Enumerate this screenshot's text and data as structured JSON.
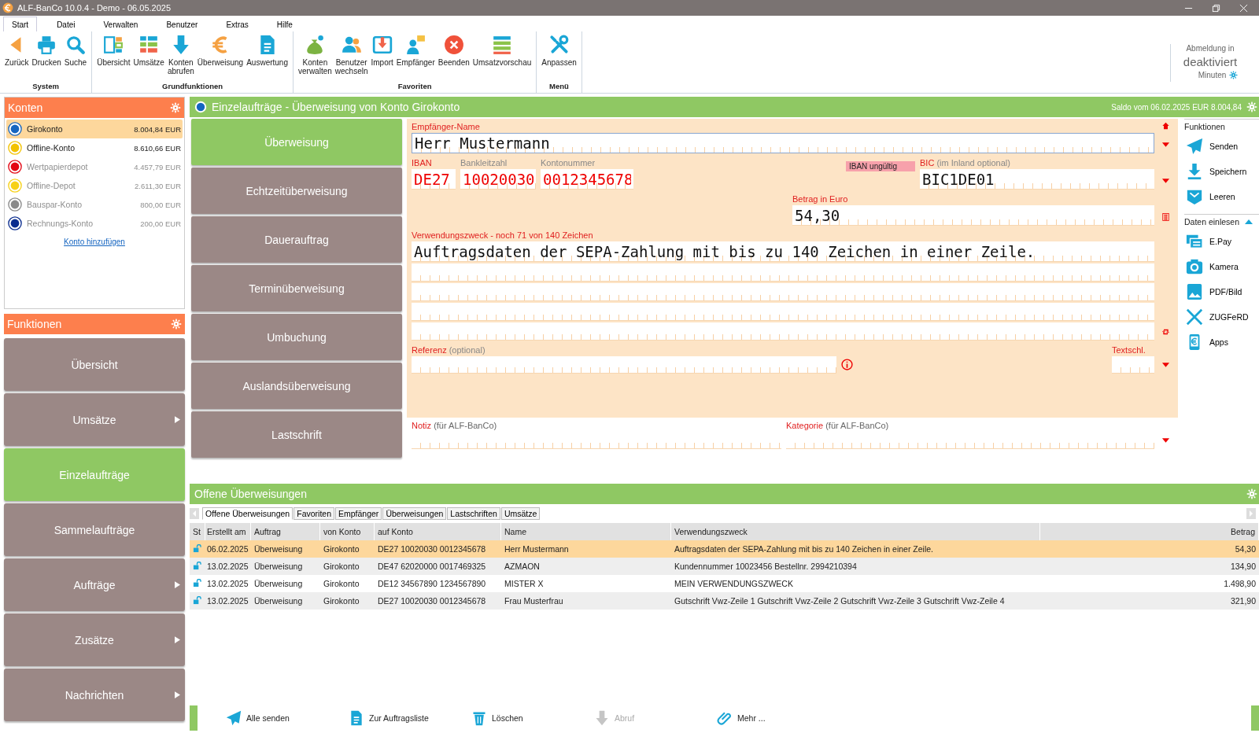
{
  "window": {
    "title": "ALF-BanCo 10.0.4 - Demo  -  06.05.2025"
  },
  "menu_tabs": [
    {
      "label": "Start",
      "selected": true
    },
    {
      "label": "Datei",
      "selected": false
    },
    {
      "label": "Verwalten",
      "selected": false
    },
    {
      "label": "Benutzer",
      "selected": false
    },
    {
      "label": "Extras",
      "selected": false
    },
    {
      "label": "Hilfe",
      "selected": false
    }
  ],
  "ribbon": [
    {
      "label": "System",
      "items": [
        {
          "label": "Zurück",
          "kind": "back"
        },
        {
          "label": "Drucken",
          "kind": "print"
        },
        {
          "label": "Suche",
          "kind": "search"
        }
      ]
    },
    {
      "label": "Grundfunktionen",
      "items": [
        {
          "label": "Übersicht",
          "kind": "overview"
        },
        {
          "label": "Umsätze",
          "kind": "list"
        },
        {
          "label": "Konten\nabrufen",
          "kind": "download"
        },
        {
          "label": "Überweisung",
          "kind": "euro"
        },
        {
          "label": "Auswertung",
          "kind": "doc"
        }
      ]
    },
    {
      "label": "Favoriten",
      "items": [
        {
          "label": "Konten\nverwalten",
          "kind": "moneybag"
        },
        {
          "label": "Benutzer\nwechseln",
          "kind": "users"
        },
        {
          "label": "Import",
          "kind": "import"
        },
        {
          "label": "Empfänger",
          "kind": "recipient"
        },
        {
          "label": "Beenden",
          "kind": "exit"
        },
        {
          "label": "Umsatzvorschau",
          "kind": "preview"
        }
      ]
    },
    {
      "label": "Menü",
      "items": [
        {
          "label": "Anpassen",
          "kind": "tools"
        }
      ]
    }
  ],
  "logout": {
    "label": "Abmeldung in",
    "value": "deaktiviert",
    "unit": "Minuten"
  },
  "accounts": {
    "title": "Konten",
    "items": [
      {
        "name": "Girokonto",
        "balance": "8.004,84 EUR",
        "selected": true,
        "disabled": false,
        "color": "#1565c0"
      },
      {
        "name": "Offline-Konto",
        "balance": "8.610,66 EUR",
        "selected": false,
        "disabled": false,
        "color": "#f2c200"
      },
      {
        "name": "Wertpapierdepot",
        "balance": "4.457,79 EUR",
        "selected": false,
        "disabled": true,
        "color": "#e30613"
      },
      {
        "name": "Offline-Depot",
        "balance": "2.611,30 EUR",
        "selected": false,
        "disabled": true,
        "color": "#f7d117"
      },
      {
        "name": "Bauspar-Konto",
        "balance": "800,00 EUR",
        "selected": false,
        "disabled": true,
        "color": "#8a8a8a"
      },
      {
        "name": "Rechnungs-Konto",
        "balance": "200,00 EUR",
        "selected": false,
        "disabled": true,
        "color": "#0b2d8f"
      }
    ],
    "add_link": "Konto hinzufügen"
  },
  "functions": {
    "title": "Funktionen",
    "items": [
      {
        "label": "Übersicht",
        "selected": false,
        "submenu": false
      },
      {
        "label": "Umsätze",
        "selected": false,
        "submenu": true
      },
      {
        "label": "Einzelaufträge",
        "selected": true,
        "submenu": false
      },
      {
        "label": "Sammelaufträge",
        "selected": false,
        "submenu": false
      },
      {
        "label": "Aufträge",
        "selected": false,
        "submenu": true
      },
      {
        "label": "Zusätze",
        "selected": false,
        "submenu": true
      },
      {
        "label": "Nachrichten",
        "selected": false,
        "submenu": true
      }
    ]
  },
  "order": {
    "title": "Einzelaufträge - Überweisung von Konto Girokonto",
    "saldo": "Saldo vom 06.02.2025 EUR 8.004,84",
    "types": [
      {
        "label": "Überweisung",
        "selected": true
      },
      {
        "label": "Echtzeitüberweisung",
        "selected": false
      },
      {
        "label": "Dauerauftrag",
        "selected": false
      },
      {
        "label": "Terminüberweisung",
        "selected": false
      },
      {
        "label": "Umbuchung",
        "selected": false
      },
      {
        "label": "Auslandsüberweisung",
        "selected": false
      },
      {
        "label": "Lastschrift",
        "selected": false
      }
    ]
  },
  "form": {
    "recipient": {
      "label": "Empfänger-Name",
      "value": "Herr Mustermann"
    },
    "iban": {
      "label": "IBAN",
      "value": "DE27"
    },
    "blz": {
      "label": "Bankleitzahl",
      "value": "10020030"
    },
    "account_number": {
      "label": "Kontonummer",
      "value": "0012345678"
    },
    "iban_invalid": true,
    "iban_error": "IBAN ungültig",
    "bic": {
      "label": "BIC",
      "hint": "(im Inland optional)",
      "value": "BIC1DE01"
    },
    "amount": {
      "label": "Betrag in Euro",
      "value": "54,30"
    },
    "purpose": {
      "label": "Verwendungszweck - noch 71 von 140 Zeichen",
      "lines": [
        "Auftragsdaten der SEPA-Zahlung mit bis zu 140 Zeichen in einer Zeile."
      ]
    },
    "reference": {
      "label": "Referenz",
      "hint": "(optional)"
    },
    "text_key": {
      "label": "Textschl."
    },
    "note": {
      "label": "Notiz",
      "hint": "(für ALF-BanCo)"
    },
    "category": {
      "label": "Kategorie",
      "hint": "(für ALF-BanCo)"
    }
  },
  "side_panel": [
    {
      "title": "Funktionen",
      "items": [
        {
          "label": "Senden",
          "kind": "send"
        },
        {
          "label": "Speichern",
          "kind": "save"
        },
        {
          "label": "Leeren",
          "kind": "clear"
        }
      ]
    },
    {
      "title": "Daten einlesen",
      "items": [
        {
          "label": "E.Pay",
          "kind": "epay"
        },
        {
          "label": "Kamera",
          "kind": "camera"
        },
        {
          "label": "PDF/Bild",
          "kind": "pdf"
        },
        {
          "label": "ZUGFeRD",
          "kind": "zugferd"
        },
        {
          "label": "Apps",
          "kind": "apps"
        }
      ]
    }
  ],
  "open_orders": {
    "title": "Offene Überweisungen",
    "tabs": [
      {
        "label": "Offene Überweisungen",
        "selected": true
      },
      {
        "label": "Favoriten",
        "selected": false
      },
      {
        "label": "Empfänger",
        "selected": false
      },
      {
        "label": "Überweisungen",
        "selected": false
      },
      {
        "label": "Lastschriften",
        "selected": false
      },
      {
        "label": "Umsätze",
        "selected": false
      }
    ],
    "columns": [
      "St",
      "Erstellt am",
      "Auftrag",
      "von Konto",
      "auf Konto",
      "Name",
      "Verwendungszweck",
      "Betrag"
    ],
    "rows": [
      {
        "selected": true,
        "cells": [
          "",
          "06.02.2025",
          "Überweisung",
          "Girokonto",
          "DE27 10020030 0012345678",
          "Herr Mustermann",
          "Auftragsdaten der SEPA-Zahlung mit bis zu 140 Zeichen in einer Zeile.",
          "54,30"
        ]
      },
      {
        "selected": false,
        "cells": [
          "",
          "13.02.2025",
          "Überweisung",
          "Girokonto",
          "DE47 62020000 0017469325",
          "AZMAON",
          "Kundennummer 10023456 Bestellnr. 2994210394",
          "134,90"
        ]
      },
      {
        "selected": false,
        "cells": [
          "",
          "13.02.2025",
          "Überweisung",
          "Girokonto",
          "DE12 34567890 1234567890",
          "MISTER X",
          "MEIN VERWENDUNGSZWECK",
          "1.498,90"
        ]
      },
      {
        "selected": false,
        "cells": [
          "",
          "13.02.2025",
          "Überweisung",
          "Girokonto",
          "DE27 10020030 0012345678",
          "Frau Musterfrau",
          "Gutschrift Vwz-Zeile 1 Gutschrift Vwz-Zeile 2 Gutschrift Vwz-Zeile 3 Gutschrift Vwz-Zeile 4",
          "321,90"
        ]
      }
    ]
  },
  "actions": [
    {
      "label": "Alle senden",
      "kind": "send",
      "disabled": false
    },
    {
      "label": "Zur Auftragsliste",
      "kind": "doc",
      "disabled": false
    },
    {
      "label": "Löschen",
      "kind": "trash",
      "disabled": false
    },
    {
      "label": "Abruf",
      "kind": "download",
      "disabled": true
    },
    {
      "label": "Mehr ...",
      "kind": "clip",
      "disabled": false
    }
  ]
}
